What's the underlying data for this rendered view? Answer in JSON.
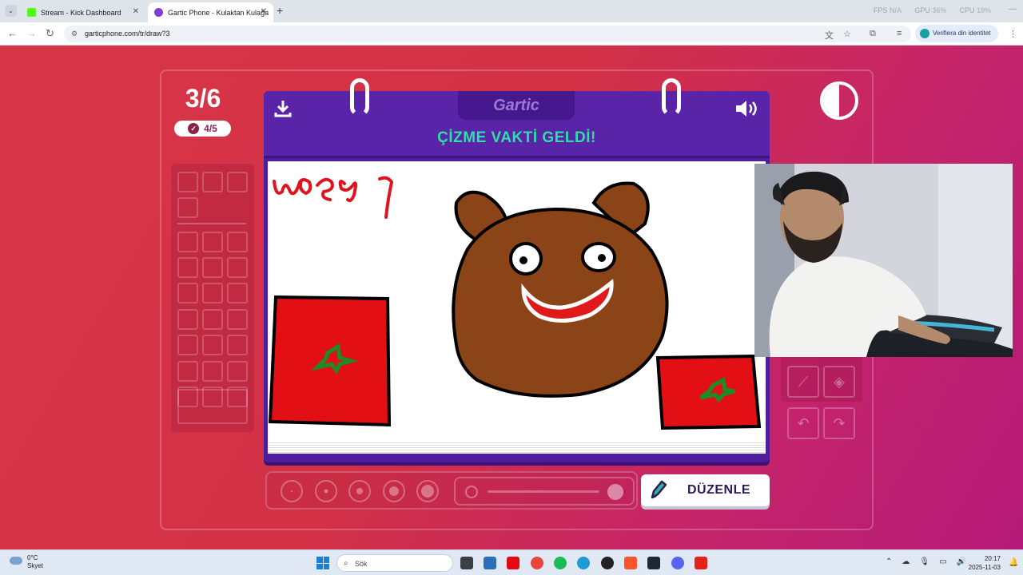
{
  "browser": {
    "tabs": [
      {
        "title": "Stream - Kick Dashboard",
        "favicon_color": "#53fc18",
        "active": false
      },
      {
        "title": "Gartic Phone - Kulaktan Kulağa",
        "favicon_color": "#7b3fd1",
        "active": true
      }
    ],
    "new_tab": "+",
    "stats": {
      "fps_label": "FPS",
      "fps_value": "N/A",
      "gpu_label": "GPU",
      "gpu_value": "36%",
      "cpu_label": "CPU",
      "cpu_value": "19%"
    },
    "url": "garticphone.com/tr/draw?3",
    "profile_button": "Verifiera din identitet"
  },
  "game": {
    "round": "3/6",
    "done_count": "4/5",
    "logo": "Gartic",
    "heading": "ÇİZME VAKTİ GELDİ!",
    "edit_button": "DÜZENLE",
    "drawing_text": "ԱԳ91",
    "accent": "#2ee0a8",
    "book_color": "#4f1d9b"
  },
  "taskbar": {
    "weather_temp": "0°C",
    "weather_desc": "Skyet",
    "search_placeholder": "Sök",
    "time": "20:17",
    "date": "2025-11-03"
  }
}
